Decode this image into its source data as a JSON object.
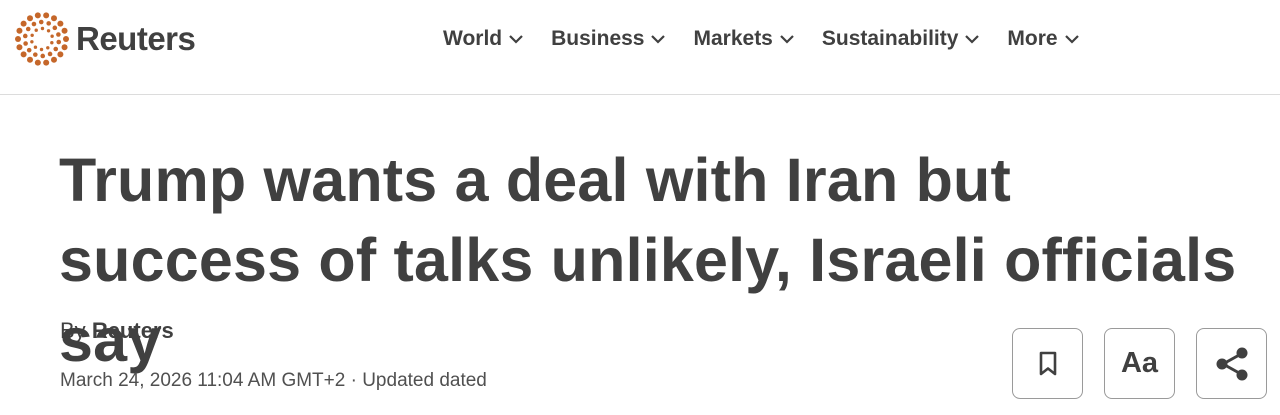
{
  "brand": {
    "name": "Reuters",
    "logo_color": "#c5672a",
    "logo_icon": "reuters-dot-ring-icon"
  },
  "nav": {
    "items": [
      {
        "label": "World",
        "icon": "chevron-down-icon"
      },
      {
        "label": "Business",
        "icon": "chevron-down-icon"
      },
      {
        "label": "Markets",
        "icon": "chevron-down-icon"
      },
      {
        "label": "Sustainability",
        "icon": "chevron-down-icon"
      },
      {
        "label": "More",
        "icon": "chevron-down-icon"
      }
    ]
  },
  "article": {
    "headline": "Trump wants a deal with Iran but success of talks unlikely, Israeli officials say",
    "byline_prefix": "By",
    "author": "Reuters",
    "dateline": "March 24, 2026 11:04 AM GMT+2 · Updated dated"
  },
  "actions": {
    "bookmark_icon": "bookmark-icon",
    "text_size_label": "Aa",
    "share_icon": "share-icon"
  }
}
